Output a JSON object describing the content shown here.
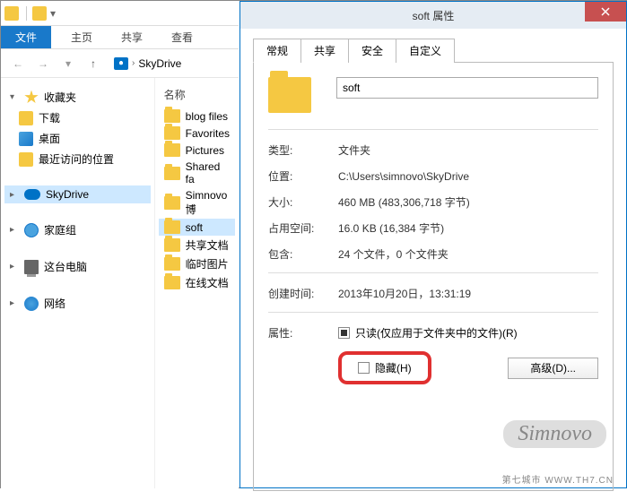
{
  "explorer": {
    "ribbon": {
      "file": "文件",
      "home": "主页",
      "share": "共享",
      "view": "查看"
    },
    "breadcrumb": {
      "location": "SkyDrive"
    },
    "sidebar": {
      "favorites": {
        "label": "收藏夹",
        "items": [
          "下载",
          "桌面",
          "最近访问的位置"
        ]
      },
      "skydrive": "SkyDrive",
      "homegroup": "家庭组",
      "thispc": "这台电脑",
      "network": "网络"
    },
    "files": {
      "header": "名称",
      "items": [
        "blog files",
        "Favorites",
        "Pictures",
        "Shared fa",
        "Simnovo博",
        "soft",
        "共享文档",
        "临时图片",
        "在线文档"
      ],
      "selected": "soft"
    }
  },
  "dialog": {
    "title": "soft 属性",
    "tabs": {
      "general": "常规",
      "share": "共享",
      "security": "安全",
      "custom": "自定义"
    },
    "name": "soft",
    "rows": {
      "type_l": "类型:",
      "type_v": "文件夹",
      "loc_l": "位置:",
      "loc_v": "C:\\Users\\simnovo\\SkyDrive",
      "size_l": "大小:",
      "size_v": "460 MB (483,306,718 字节)",
      "disk_l": "占用空间:",
      "disk_v": "16.0 KB (16,384 字节)",
      "cont_l": "包含:",
      "cont_v": "24 个文件，0 个文件夹",
      "ctime_l": "创建时间:",
      "ctime_v": "2013年10月20日，13:31:19",
      "attr_l": "属性:",
      "readonly": "只读(仅应用于文件夹中的文件)(R)",
      "hidden": "隐藏(H)",
      "advanced": "高级(D)..."
    }
  },
  "watermark": "Simnovo",
  "footer": "第七城市 WWW.TH7.CN"
}
